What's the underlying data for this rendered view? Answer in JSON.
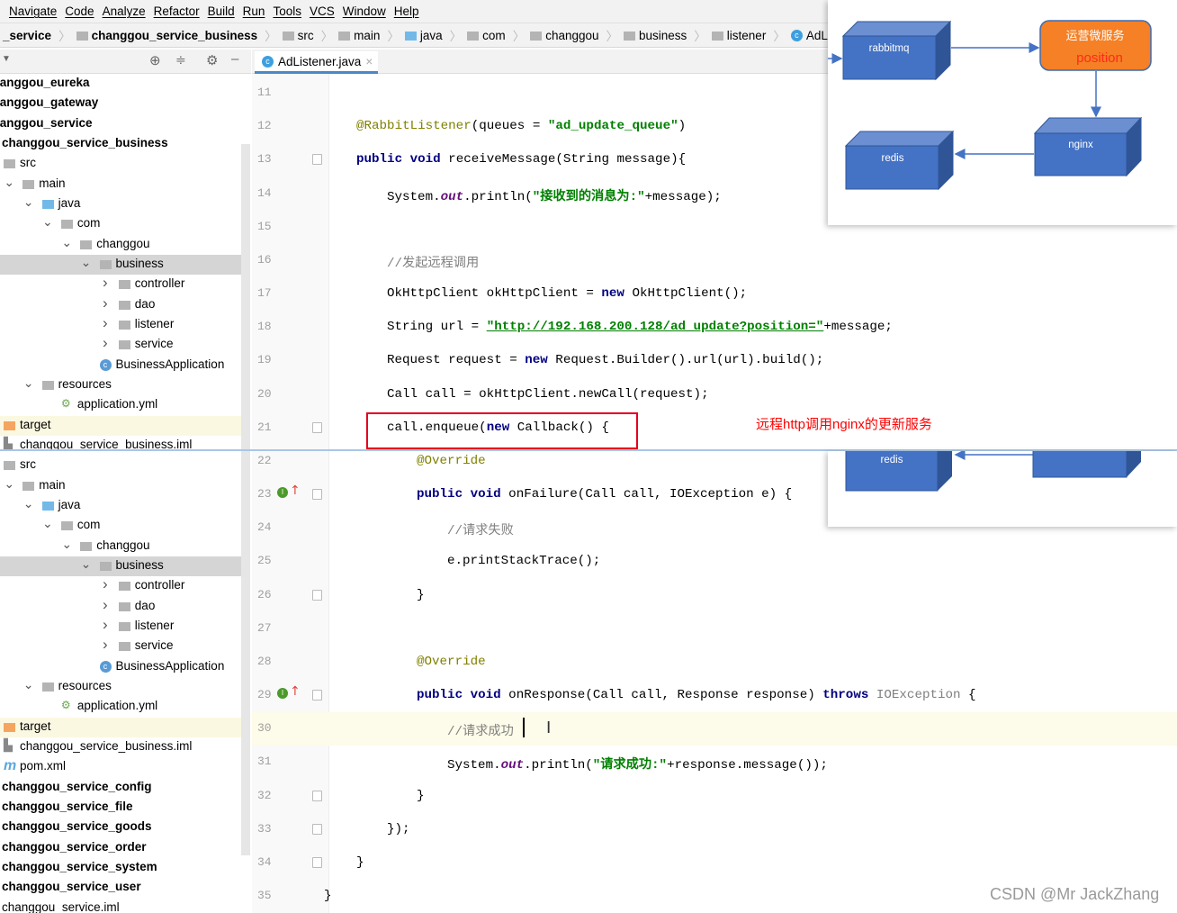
{
  "menu": [
    "Navigate",
    "Code",
    "Analyze",
    "Refactor",
    "Build",
    "Run",
    "Tools",
    "VCS",
    "Window",
    "Help"
  ],
  "breadcrumbs": [
    {
      "label": "_service",
      "icon": "none",
      "bold": true
    },
    {
      "label": "changgou_service_business",
      "icon": "module-folder-icon",
      "bold": true
    },
    {
      "label": "src",
      "icon": "folder-icon"
    },
    {
      "label": "main",
      "icon": "folder-icon"
    },
    {
      "label": "java",
      "icon": "source-folder-icon"
    },
    {
      "label": "com",
      "icon": "package-icon"
    },
    {
      "label": "changgou",
      "icon": "package-icon"
    },
    {
      "label": "business",
      "icon": "package-icon"
    },
    {
      "label": "listener",
      "icon": "package-icon"
    },
    {
      "label": "AdListener",
      "icon": "class-icon"
    }
  ],
  "editor_tab": {
    "label": "AdListener.java",
    "close": "×"
  },
  "sidebar": {
    "rows": [
      {
        "label": "changgou_eureka",
        "level": -1,
        "bold": true
      },
      {
        "label": "changgou_gateway",
        "level": -1,
        "bold": true
      },
      {
        "label": "changgou_service",
        "level": -1,
        "bold": true
      },
      {
        "label": "changgou_service_business",
        "level": 0,
        "bold": true
      },
      {
        "label": "src",
        "level": 1,
        "icon": "folder"
      },
      {
        "label": "main",
        "level": 2,
        "icon": "folder",
        "chev": "open"
      },
      {
        "label": "java",
        "level": 3,
        "icon": "source",
        "chev": "open"
      },
      {
        "label": "com",
        "level": 4,
        "icon": "package",
        "chev": "open"
      },
      {
        "label": "changgou",
        "level": 5,
        "icon": "package",
        "chev": "open"
      },
      {
        "label": "business",
        "level": 6,
        "icon": "package",
        "chev": "open",
        "selected": true
      },
      {
        "label": "controller",
        "level": 7,
        "icon": "package",
        "chev": "closed"
      },
      {
        "label": "dao",
        "level": 7,
        "icon": "package",
        "chev": "closed"
      },
      {
        "label": "listener",
        "level": 7,
        "icon": "package",
        "chev": "closed"
      },
      {
        "label": "service",
        "level": 7,
        "icon": "package",
        "chev": "closed"
      },
      {
        "label": "BusinessApplication",
        "level": 6,
        "icon": "spring-class"
      },
      {
        "label": "resources",
        "level": 3,
        "icon": "resources",
        "chev": "open"
      },
      {
        "label": "application.yml",
        "level": 4,
        "icon": "yml"
      },
      {
        "label": "target",
        "level": 1,
        "icon": "target",
        "target": true
      },
      {
        "label": "changgou_service_business.iml",
        "level": 1,
        "icon": "iml"
      },
      {
        "label": "src",
        "level": 1,
        "icon": "folder"
      },
      {
        "label": "main",
        "level": 2,
        "icon": "folder",
        "chev": "open"
      },
      {
        "label": "java",
        "level": 3,
        "icon": "source",
        "chev": "open"
      },
      {
        "label": "com",
        "level": 4,
        "icon": "package",
        "chev": "open"
      },
      {
        "label": "changgou",
        "level": 5,
        "icon": "package",
        "chev": "open"
      },
      {
        "label": "business",
        "level": 6,
        "icon": "package",
        "chev": "open",
        "selected": true
      },
      {
        "label": "controller",
        "level": 7,
        "icon": "package",
        "chev": "closed"
      },
      {
        "label": "dao",
        "level": 7,
        "icon": "package",
        "chev": "closed"
      },
      {
        "label": "listener",
        "level": 7,
        "icon": "package",
        "chev": "closed"
      },
      {
        "label": "service",
        "level": 7,
        "icon": "package",
        "chev": "closed"
      },
      {
        "label": "BusinessApplication",
        "level": 6,
        "icon": "spring-class"
      },
      {
        "label": "resources",
        "level": 3,
        "icon": "resources",
        "chev": "open"
      },
      {
        "label": "application.yml",
        "level": 4,
        "icon": "yml"
      },
      {
        "label": "target",
        "level": 1,
        "icon": "target",
        "target": true
      },
      {
        "label": "changgou_service_business.iml",
        "level": 1,
        "icon": "iml"
      },
      {
        "label": "pom.xml",
        "level": 1,
        "icon": "maven"
      },
      {
        "label": "changgou_service_config",
        "level": 0,
        "bold": true
      },
      {
        "label": "changgou_service_file",
        "level": 0,
        "bold": true
      },
      {
        "label": "changgou_service_goods",
        "level": 0,
        "bold": true
      },
      {
        "label": "changgou_service_order",
        "level": 0,
        "bold": true
      },
      {
        "label": "changgou_service_system",
        "level": 0,
        "bold": true
      },
      {
        "label": "changgou_service_user",
        "level": 0,
        "bold": true
      },
      {
        "label": "changgou_service.iml",
        "level": 0
      }
    ]
  },
  "code": {
    "lines": [
      {
        "n": "11",
        "ind": 1,
        "tokens": []
      },
      {
        "n": "12",
        "ind": 1,
        "tokens": [
          {
            "t": "@RabbitListener",
            "c": "a"
          },
          {
            "t": "(queues = ",
            "c": "p"
          },
          {
            "t": "\"ad_update_queue\"",
            "c": "s"
          },
          {
            "t": ")",
            "c": "p"
          }
        ]
      },
      {
        "n": "13",
        "ind": 1,
        "fold": true,
        "tokens": [
          {
            "t": "public",
            "c": "k"
          },
          {
            "t": " ",
            "c": "p"
          },
          {
            "t": "void",
            "c": "k"
          },
          {
            "t": " receiveMessage(String message){",
            "c": "p"
          }
        ]
      },
      {
        "n": "14",
        "ind": 2,
        "tokens": [
          {
            "t": "System.",
            "c": "p"
          },
          {
            "t": "out",
            "c": "st"
          },
          {
            "t": ".println(",
            "c": "p"
          },
          {
            "t": "\"接收到的消息为:\"",
            "c": "s"
          },
          {
            "t": "+message);",
            "c": "p"
          }
        ]
      },
      {
        "n": "15",
        "ind": 2,
        "tokens": []
      },
      {
        "n": "16",
        "ind": 2,
        "tokens": [
          {
            "t": "//发起远程调用",
            "c": "c"
          }
        ]
      },
      {
        "n": "17",
        "ind": 2,
        "tokens": [
          {
            "t": "OkHttpClient okHttpClient = ",
            "c": "p"
          },
          {
            "t": "new",
            "c": "k"
          },
          {
            "t": " OkHttpClient();",
            "c": "p"
          }
        ]
      },
      {
        "n": "18",
        "ind": 2,
        "tokens": [
          {
            "t": "String url = ",
            "c": "p"
          },
          {
            "t": "\"http://192.168.200.128/ad_update?position=\"",
            "c": "u"
          },
          {
            "t": "+message;",
            "c": "p"
          }
        ]
      },
      {
        "n": "19",
        "ind": 2,
        "tokens": [
          {
            "t": "Request request = ",
            "c": "p"
          },
          {
            "t": "new",
            "c": "k"
          },
          {
            "t": " Request.Builder().url(url).build();",
            "c": "p"
          }
        ]
      },
      {
        "n": "20",
        "ind": 2,
        "tokens": [
          {
            "t": "Call call = okHttpClient.newCall(request);",
            "c": "p"
          }
        ]
      },
      {
        "n": "21",
        "ind": 2,
        "fold": true,
        "tokens": [
          {
            "t": "call.enqueue(",
            "c": "p"
          },
          {
            "t": "new",
            "c": "k"
          },
          {
            "t": " Callback() {",
            "c": "p"
          }
        ]
      },
      {
        "n": "22",
        "ind": 3,
        "tokens": [
          {
            "t": "@Override",
            "c": "a"
          }
        ]
      },
      {
        "n": "23",
        "ind": 3,
        "fold": true,
        "override": true,
        "tokens": [
          {
            "t": "public",
            "c": "k"
          },
          {
            "t": " ",
            "c": "p"
          },
          {
            "t": "void",
            "c": "k"
          },
          {
            "t": " onFailure(Call call, IOException e) {",
            "c": "p"
          }
        ]
      },
      {
        "n": "24",
        "ind": 4,
        "tokens": [
          {
            "t": "//请求失败",
            "c": "c"
          }
        ]
      },
      {
        "n": "25",
        "ind": 4,
        "tokens": [
          {
            "t": "e.printStackTrace();",
            "c": "p"
          }
        ]
      },
      {
        "n": "26",
        "ind": 3,
        "fold": true,
        "tokens": [
          {
            "t": "}",
            "c": "p"
          }
        ]
      },
      {
        "n": "27",
        "ind": 3,
        "tokens": []
      },
      {
        "n": "28",
        "ind": 3,
        "tokens": [
          {
            "t": "@Override",
            "c": "a"
          }
        ]
      },
      {
        "n": "29",
        "ind": 3,
        "fold": true,
        "override": true,
        "tokens": [
          {
            "t": "public",
            "c": "k"
          },
          {
            "t": " ",
            "c": "p"
          },
          {
            "t": "void",
            "c": "k"
          },
          {
            "t": " onResponse(Call call, Response response) ",
            "c": "p"
          },
          {
            "t": "throws",
            "c": "k"
          },
          {
            "t": " IOException",
            "c": "g"
          },
          {
            "t": " {",
            "c": "p"
          }
        ]
      },
      {
        "n": "30",
        "ind": 4,
        "current": true,
        "tokens": [
          {
            "t": "//请求成功",
            "c": "c"
          }
        ]
      },
      {
        "n": "31",
        "ind": 4,
        "tokens": [
          {
            "t": "System.",
            "c": "p"
          },
          {
            "t": "out",
            "c": "st"
          },
          {
            "t": ".println(",
            "c": "p"
          },
          {
            "t": "\"请求成功:\"",
            "c": "s"
          },
          {
            "t": "+response.message());",
            "c": "p"
          }
        ]
      },
      {
        "n": "32",
        "ind": 3,
        "fold": true,
        "tokens": [
          {
            "t": "}",
            "c": "p"
          }
        ]
      },
      {
        "n": "33",
        "ind": 2,
        "fold": true,
        "tokens": [
          {
            "t": "});",
            "c": "p"
          }
        ]
      },
      {
        "n": "34",
        "ind": 1,
        "fold": true,
        "tokens": [
          {
            "t": "}",
            "c": "p"
          }
        ]
      },
      {
        "n": "35",
        "ind": 0,
        "tokens": [
          {
            "t": "}",
            "c": "p"
          }
        ]
      }
    ]
  },
  "annotation_note": "远程http调用nginx的更新服务",
  "diagram": {
    "rabbitmq": "rabbitmq",
    "service_title": "运营微服务",
    "service_sub": "position",
    "nginx": "nginx",
    "redis": "redis",
    "redis_2": "redis",
    "colors": {
      "box_front": "#4472c4",
      "box_top": "#6b8fd1",
      "box_side": "#2f5597",
      "service": "#f58025",
      "service_sub": "#ff2a1a"
    }
  },
  "watermark": "CSDN @Mr JackZhang"
}
